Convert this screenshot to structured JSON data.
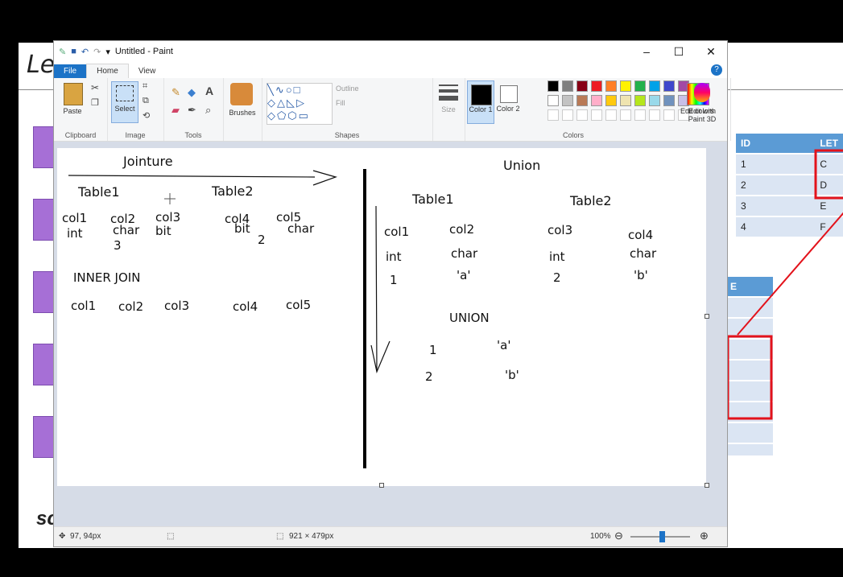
{
  "slide": {
    "title": "Le",
    "footer": "sc",
    "table1": {
      "header": [
        "ID",
        "LET"
      ],
      "rows": [
        [
          "1",
          "C"
        ],
        [
          "2",
          "D"
        ],
        [
          "3",
          "E"
        ],
        [
          "4",
          "F"
        ]
      ]
    },
    "table2": {
      "header": "E"
    }
  },
  "paint": {
    "window_title": "Untitled - Paint",
    "tabs": [
      "File",
      "Home",
      "View"
    ],
    "groups": {
      "clipboard": "Clipboard",
      "image": "Image",
      "tools": "Tools",
      "shapes": "Shapes",
      "colors": "Colors"
    },
    "buttons": {
      "paste": "Paste",
      "select": "Select",
      "brushes": "Brushes",
      "outline": "Outline",
      "fill": "Fill",
      "size": "Size",
      "color1": "Color 1",
      "color2": "Color 2",
      "edit_colors": "Edit colors",
      "edit_paint3d": "Edit with Paint 3D"
    },
    "palette_row1": [
      "#000000",
      "#7f7f7f",
      "#880015",
      "#ed1c24",
      "#ff7f27",
      "#fff200",
      "#22b14c",
      "#00a2e8",
      "#3f48cc",
      "#a349a4"
    ],
    "palette_row2": [
      "#ffffff",
      "#c3c3c3",
      "#b97a57",
      "#ffaec9",
      "#ffc90e",
      "#efe4b0",
      "#b5e61d",
      "#99d9ea",
      "#7092be",
      "#c8bfe7"
    ],
    "status": {
      "cursor": "97, 94px",
      "canvas_size": "921 × 479px",
      "zoom": "100%"
    }
  },
  "drawing": {
    "jointure": "Jointure",
    "union": "Union",
    "left_table1": "Table1",
    "left_table2": "Table2",
    "left_cols": [
      "col1",
      "col2",
      "col3",
      "col4",
      "col5"
    ],
    "left_types": [
      "int",
      "char",
      "bit",
      "bit",
      "char"
    ],
    "left_vals": [
      "3",
      "2"
    ],
    "inner_join": "INNER JOIN",
    "join_cols": [
      "col1",
      "col2",
      "col3",
      "col4",
      "col5"
    ],
    "right_table1": "Table1",
    "right_table2": "Table2",
    "right_cols": [
      "col1",
      "col2",
      "col3",
      "col4"
    ],
    "right_types": [
      "int",
      "char",
      "int",
      "char"
    ],
    "right_vals": [
      "1",
      "'a'",
      "2",
      "'b'"
    ],
    "union_word": "UNION",
    "union_rows": [
      [
        "1",
        "'a'"
      ],
      [
        "2",
        "'b'"
      ]
    ]
  }
}
